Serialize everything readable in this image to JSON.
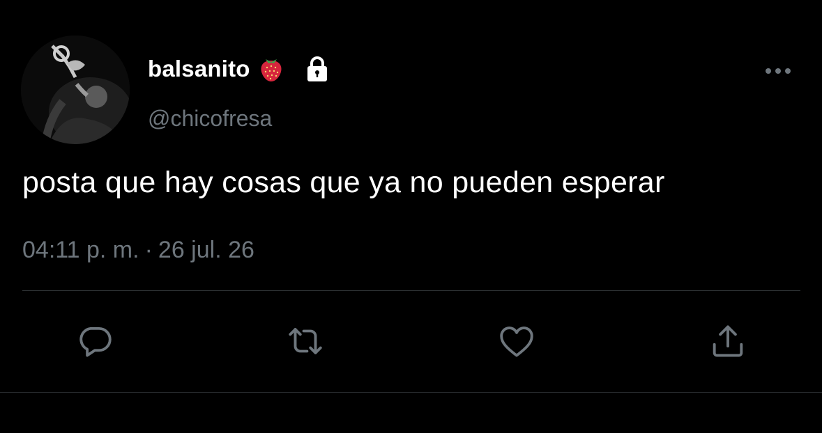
{
  "tweet": {
    "display_name": "balsanito",
    "handle": "@chicofresa",
    "text": "posta que hay cosas que ya no pueden esperar",
    "time": "04:11 p. m.",
    "separator": "·",
    "date": "26 jul. 26"
  },
  "icons": {
    "name_emoji": "strawberry-icon",
    "protected": "lock-icon",
    "more": "more-horizontal-icon",
    "reply": "reply-icon",
    "retweet": "retweet-icon",
    "like": "heart-icon",
    "share": "share-icon"
  },
  "colors": {
    "background": "#000000",
    "primary_text": "#ffffff",
    "secondary_text": "#6e767d",
    "divider": "#2f3336",
    "strawberry": "#d7263d"
  }
}
